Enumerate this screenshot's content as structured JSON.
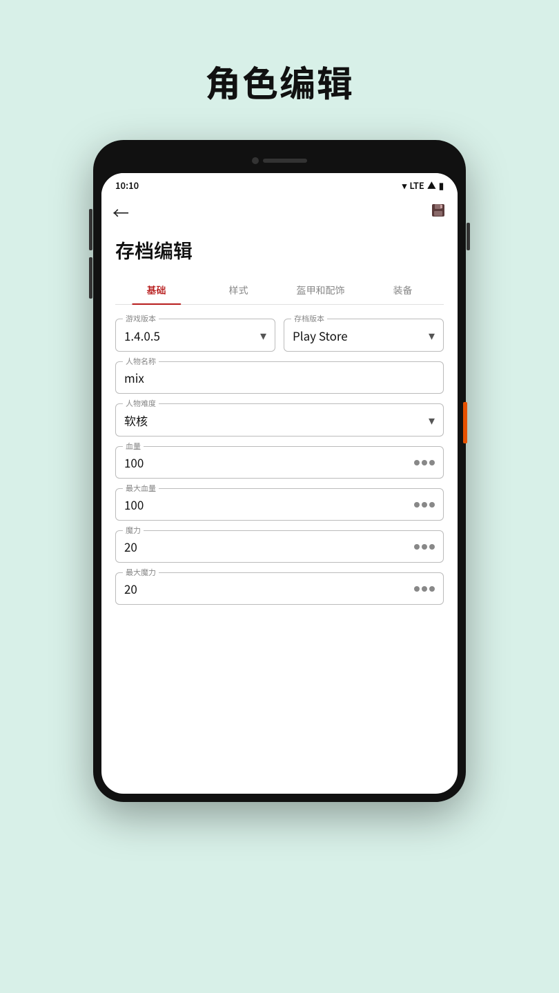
{
  "page": {
    "title": "角色编辑",
    "background": "#d8f0e8"
  },
  "status_bar": {
    "time": "10:10",
    "lte": "LTE"
  },
  "app_bar": {
    "back_label": "←",
    "save_label": "💾"
  },
  "screen": {
    "archive_title": "存档编辑",
    "tabs": [
      {
        "label": "基础",
        "active": true
      },
      {
        "label": "样式",
        "active": false
      },
      {
        "label": "盔甲和配饰",
        "active": false
      },
      {
        "label": "装备",
        "active": false
      }
    ],
    "fields": {
      "game_version": {
        "label": "游戏版本",
        "value": "1.4.0.5"
      },
      "save_version": {
        "label": "存档版本",
        "value": "Play Store"
      },
      "character_name": {
        "label": "人物名称",
        "value": "mix"
      },
      "difficulty": {
        "label": "人物难度",
        "value": "软核"
      },
      "health": {
        "label": "血量",
        "value": "100"
      },
      "max_health": {
        "label": "最大血量",
        "value": "100"
      },
      "mana": {
        "label": "魔力",
        "value": "20"
      },
      "max_mana": {
        "label": "最大魔力",
        "value": "20"
      }
    }
  }
}
